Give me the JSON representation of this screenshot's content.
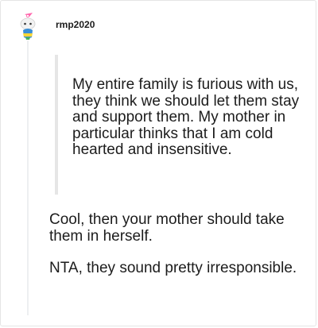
{
  "comment": {
    "username": "rmp2020",
    "avatar_icon": "reddit-snoo-avatar-icon",
    "quote": "My entire family is furious with us, they think we should let them stay and support them. My mother in particular thinks that I am cold hearted and insensitive.",
    "paragraphs": [
      "Cool, then your mother should take them in herself.",
      "NTA, they sound pretty irresponsible."
    ]
  },
  "colors": {
    "text": "#1c1c1c",
    "thread_line": "#edeff1",
    "quote_bar": "#e6e6e6",
    "avatar_accent": "#ff66ac"
  }
}
